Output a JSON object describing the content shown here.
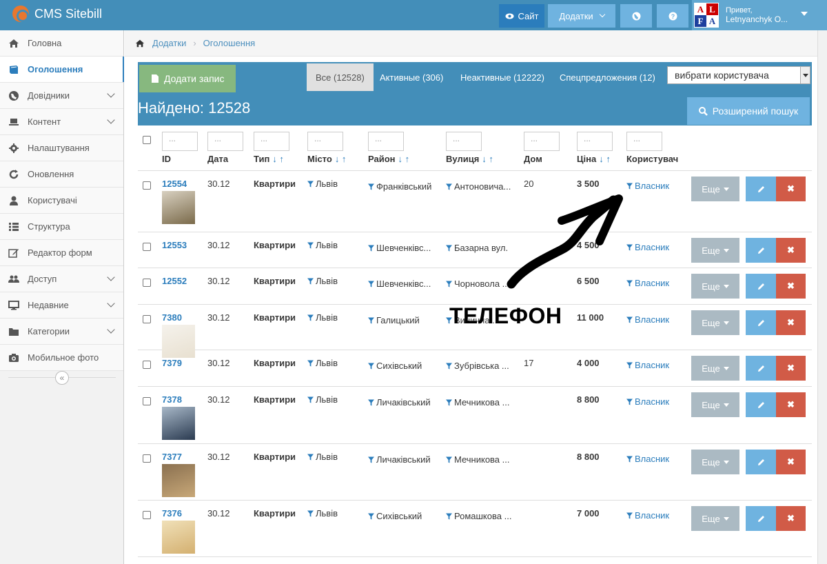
{
  "navbar": {
    "brand": "CMS Sitebill",
    "site_label": "Сайт",
    "addons_label": "Додатки",
    "avatar_letters": [
      "A",
      "L",
      "F",
      "A"
    ],
    "greeting": "Привет,",
    "user_name": "Letnyanchyk O...",
    "colors": {
      "bar": "#438eb9",
      "button": "#6fb3e0"
    }
  },
  "sidebar": {
    "items": [
      {
        "label": "Головна",
        "icon": "home-icon"
      },
      {
        "label": "Оголошення",
        "icon": "book-icon",
        "active": true
      },
      {
        "label": "Довідники",
        "icon": "globe-icon",
        "expandable": true
      },
      {
        "label": "Контент",
        "icon": "laptop-icon",
        "expandable": true
      },
      {
        "label": "Налаштування",
        "icon": "gear-icon"
      },
      {
        "label": "Оновлення",
        "icon": "refresh-icon"
      },
      {
        "label": "Користувачі",
        "icon": "user-icon"
      },
      {
        "label": "Структура",
        "icon": "list-icon"
      },
      {
        "label": "Редактор форм",
        "icon": "edit-icon"
      },
      {
        "label": "Доступ",
        "icon": "users-icon",
        "expandable": true
      },
      {
        "label": "Недавние",
        "icon": "desktop-icon",
        "expandable": true
      },
      {
        "label": "Категории",
        "icon": "folder-icon",
        "expandable": true
      },
      {
        "label": "Мобильное фото",
        "icon": "camera-icon"
      }
    ]
  },
  "breadcrumb": {
    "items": [
      "Додатки",
      "Оголошення"
    ]
  },
  "toolbar": {
    "add_label": "Додати запис",
    "tabs": [
      "Все (12528)",
      "Активные (306)",
      "Неактивные (12222)",
      "Спецпредложения (12)"
    ],
    "user_select": "вибрати користувача"
  },
  "found_title": "Найдено: 12528",
  "advanced_search": "Розширений пошук",
  "table": {
    "filter_placeholder": "...",
    "headers": [
      "ID",
      "Дата",
      "Тип",
      "Місто",
      "Район",
      "Вулиця",
      "Дом",
      "Ціна",
      "Користувач"
    ],
    "more_label": "Еще",
    "rows": [
      {
        "id": "12554",
        "date": "30.12",
        "type": "Квартири",
        "city": "Львів",
        "district": "Франківський",
        "street": "Антоновича...",
        "house": "20",
        "price": "3 500",
        "user": "Власник",
        "photo": "room-photo"
      },
      {
        "id": "12553",
        "date": "30.12",
        "type": "Квартири",
        "city": "Львів",
        "district": "Шевченківс...",
        "street": "Базарна вул.",
        "house": "",
        "price": "4 500",
        "user": "Власник"
      },
      {
        "id": "12552",
        "date": "30.12",
        "type": "Квартири",
        "city": "Львів",
        "district": "Шевченківс...",
        "street": "Чорновола ...",
        "house": "",
        "price": "6 500",
        "user": "Власник"
      },
      {
        "id": "7380",
        "date": "30.12",
        "type": "Квартири",
        "city": "Львів",
        "district": "Галицький",
        "street": "Винична ...",
        "house": "",
        "price": "11 000",
        "user": "Власник",
        "photo": "room-photo"
      },
      {
        "id": "7379",
        "date": "30.12",
        "type": "Квартири",
        "city": "Львів",
        "district": "Сихівський",
        "street": "Зубрівська ...",
        "house": "17",
        "price": "4 000",
        "user": "Власник"
      },
      {
        "id": "7378",
        "date": "30.12",
        "type": "Квартири",
        "city": "Львів",
        "district": "Личаківський",
        "street": "Мечникова ...",
        "house": "",
        "price": "8 800",
        "user": "Власник",
        "photo": "room-photo"
      },
      {
        "id": "7377",
        "date": "30.12",
        "type": "Квартири",
        "city": "Львів",
        "district": "Личаківський",
        "street": "Мечникова ...",
        "house": "",
        "price": "8 800",
        "user": "Власник",
        "photo": "room-photo"
      },
      {
        "id": "7376",
        "date": "30.12",
        "type": "Квартири",
        "city": "Львів",
        "district": "Сихівський",
        "street": "Ромашкова ...",
        "house": "",
        "price": "7 000",
        "user": "Власник",
        "photo": "room-photo"
      }
    ]
  },
  "annotation": {
    "text": "ТЕЛЕФОН"
  }
}
